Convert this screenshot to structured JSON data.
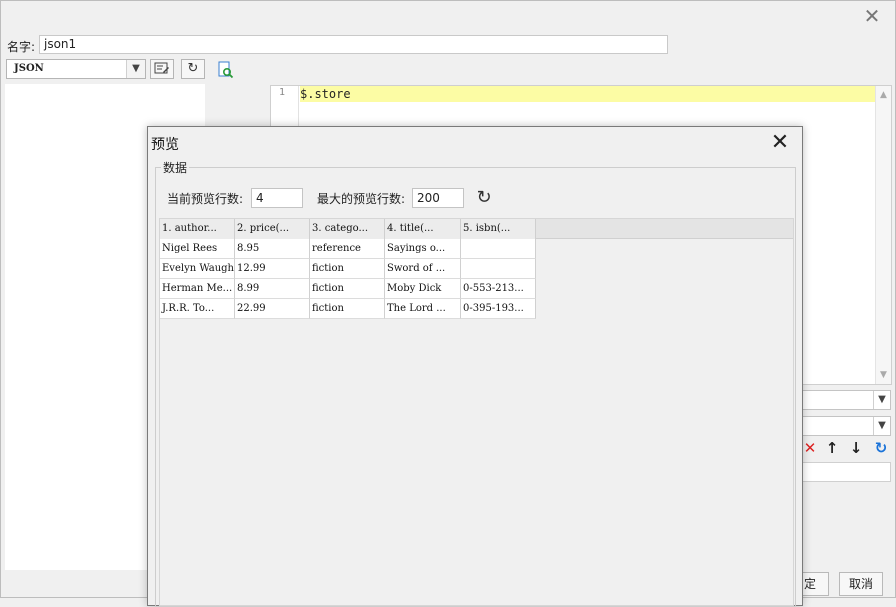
{
  "window": {
    "close_icon": "close-icon"
  },
  "name": {
    "label": "名字:",
    "value": "json1"
  },
  "toolbar": {
    "type_value": "JSON",
    "icons": [
      "edit-params-icon",
      "refresh-icon",
      "preview-search-icon"
    ]
  },
  "editor": {
    "line_number": "1",
    "code": "$.store"
  },
  "side_controls": {
    "icons": [
      "delete-icon",
      "arrow-up-icon",
      "arrow-down-icon",
      "reload-icon"
    ]
  },
  "buttons": {
    "ok_label": "定",
    "cancel_label": "取消"
  },
  "dialog": {
    "title": "预览",
    "group_label": "数据",
    "current_rows_label": "当前预览行数:",
    "current_rows_value": "4",
    "max_rows_label": "最大的预览行数:",
    "max_rows_value": "200",
    "columns": [
      "1. author...",
      "2. price(...",
      "3. catego...",
      "4. title(...",
      "5. isbn(..."
    ],
    "rows": [
      [
        "Nigel Rees",
        "8.95",
        "reference",
        "Sayings o...",
        ""
      ],
      [
        "Evelyn Waugh",
        "12.99",
        "fiction",
        "Sword of ...",
        ""
      ],
      [
        "Herman Me...",
        "8.99",
        "fiction",
        "Moby Dick",
        "0-553-213..."
      ],
      [
        "J.R.R. To...",
        "22.99",
        "fiction",
        "The Lord ...",
        "0-395-193..."
      ]
    ]
  }
}
